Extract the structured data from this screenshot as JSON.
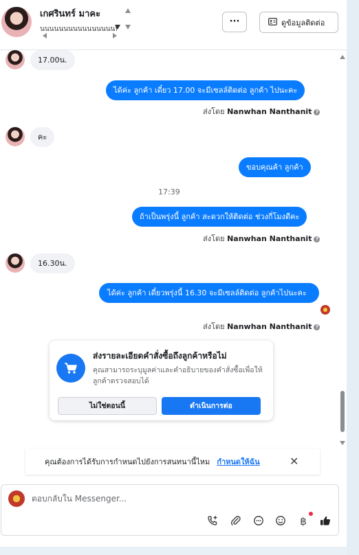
{
  "header": {
    "contact_name": "เกศรินทร์ มาคะ",
    "contact_sub": "นนนนนนนนนนนนนนนนน",
    "more_label": "···",
    "contact_info_label": "ดูข้อมูลติดต่อ"
  },
  "messages": [
    {
      "dir": "in",
      "text": "17.00น."
    },
    {
      "dir": "out",
      "text": "ได้ค่ะ  ลูกค้า เดี๋ยว 17.00 จะมีเซลล์ติดต่อ ลูกค้า ไปนะคะ",
      "sent_prefix": "ส่งโดย",
      "sent_by": "Nanwhan Nanthanit"
    },
    {
      "dir": "in",
      "text": "คะ"
    },
    {
      "dir": "out",
      "text": "ขอบคุณค้า ลูกค้า"
    },
    {
      "dir": "time",
      "text": "17:39"
    },
    {
      "dir": "out",
      "text": "ถ้าเป็นพรุ่งนี้ ลูกค้า สะดวกให้ติดต่อ ช่วงกี่โมงดีคะ",
      "sent_prefix": "ส่งโดย",
      "sent_by": "Nanwhan Nanthanit"
    },
    {
      "dir": "in",
      "text": "16.30น."
    },
    {
      "dir": "out",
      "text": "ได้ค่ะ  ลูกค้า  เดี๋ยวพรุ่งนี้  16.30 จะมีเซลล์ติดต่อ ลูกค้าไปนะคะ",
      "sent_prefix": "ส่งโดย",
      "sent_by": "Nanwhan Nanthanit"
    }
  ],
  "order_card": {
    "title": "ส่งรายละเอียดคำสั่งซื้อถึงลูกค้าหรือไม่",
    "description": "คุณสามารถระบุมูลค่าและคำอธิบายของคำสั่งซื้อเพื่อให้ลูกค้าตรวจสอบได้",
    "not_now": "ไม่ใช่ตอนนี้",
    "continue": "ดำเนินการต่อ"
  },
  "schedule_banner": {
    "text": "คุณต้องการได้รับการกำหนดไปยังการสนทนานี้ไหม",
    "link": "กำหนดให้ฉัน"
  },
  "composer": {
    "placeholder": "ตอบกลับใน Messenger..."
  },
  "toolbar_icons": [
    "phone-add-icon",
    "paperclip-icon",
    "chat-bubble-icon",
    "emoji-icon",
    "baht-icon",
    "thumbs-up-icon"
  ]
}
